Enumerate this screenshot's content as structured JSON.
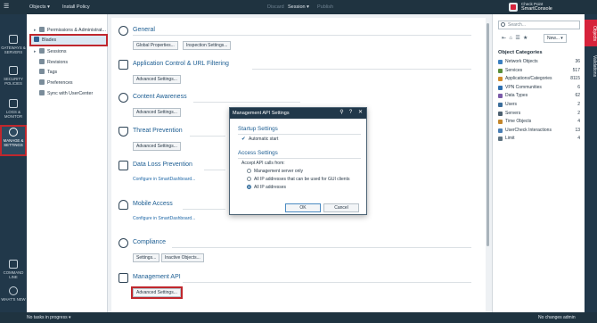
{
  "topbar": {
    "objects": "Objects ▾",
    "install_policy": "Install Policy",
    "discard": "Discard",
    "session": "Session ▾",
    "publish": "Publish",
    "brand_line1": "Check Point",
    "brand_line2": "SmartConsole"
  },
  "rail": {
    "gateways": "GATEWAYS & SERVERS",
    "security": "SECURITY POLICIES",
    "logs": "LOGS & MONITOR",
    "manage": "MANAGE & SETTINGS",
    "command_line": "COMMAND LINE",
    "whats_new": "WHAT'S NEW"
  },
  "tree": {
    "items": [
      {
        "label": "Permissions & Administrat..."
      },
      {
        "label": "Blades"
      },
      {
        "label": "Sessions"
      },
      {
        "label": "Revisions"
      },
      {
        "label": "Tags"
      },
      {
        "label": "Preferences"
      },
      {
        "label": "Sync with UserCenter"
      }
    ]
  },
  "main": {
    "general": {
      "title": "General",
      "btn1": "Global Properties...",
      "btn2": "Inspection Settings..."
    },
    "appcontrol": {
      "title": "Application Control & URL Filtering",
      "btn1": "Advanced Settings..."
    },
    "content": {
      "title": "Content Awareness",
      "btn1": "Advanced Settings..."
    },
    "threat": {
      "title": "Threat Prevention",
      "btn1": "Advanced Settings..."
    },
    "dlp": {
      "title": "Data Loss Prevention",
      "link": "Configure in SmartDashboard..."
    },
    "mobile": {
      "title": "Mobile Access",
      "link": "Configure in SmartDashboard..."
    },
    "compliance": {
      "title": "Compliance",
      "btn1": "Settings...",
      "btn2": "Inactive Objects..."
    },
    "mgmtapi": {
      "title": "Management API",
      "btn1": "Advanced Settings..."
    }
  },
  "right": {
    "search_placeholder": "Search...",
    "new_label": "New... ▾",
    "categories_title": "Object Categories",
    "categories": [
      {
        "name": "Network Objects",
        "count": "36",
        "color": "#3a7fc1"
      },
      {
        "name": "Services",
        "count": "517",
        "color": "#5b8f3a"
      },
      {
        "name": "Applications/Categories",
        "count": "8115",
        "color": "#d08a2a"
      },
      {
        "name": "VPN Communities",
        "count": "6",
        "color": "#2d6fb0"
      },
      {
        "name": "Data Types",
        "count": "62",
        "color": "#7a5aa8"
      },
      {
        "name": "Users",
        "count": "2",
        "color": "#3b6d9a"
      },
      {
        "name": "Servers",
        "count": "2",
        "color": "#4d6070"
      },
      {
        "name": "Time Objects",
        "count": "4",
        "color": "#c4862b"
      },
      {
        "name": "UserCheck Interactions",
        "count": "13",
        "color": "#4a7fb5"
      },
      {
        "name": "Limit",
        "count": "4",
        "color": "#5f7482"
      }
    ]
  },
  "vtabs": {
    "objects": "Objects",
    "validations": "Validations"
  },
  "status": {
    "tasks": "No tasks in progress ▾",
    "changes": "No changes",
    "user": "admin"
  },
  "dialog": {
    "title": "Management API Settings",
    "startup_title": "Startup Settings",
    "auto_start": "Automatic start",
    "access_title": "Access Settings",
    "accept_from": "Accept API calls from:",
    "opt1": "Management server only",
    "opt2": "All IP addresses that can be used for GUI clients",
    "opt3": "All IP addresses",
    "ok": "OK",
    "cancel": "Cancel"
  }
}
